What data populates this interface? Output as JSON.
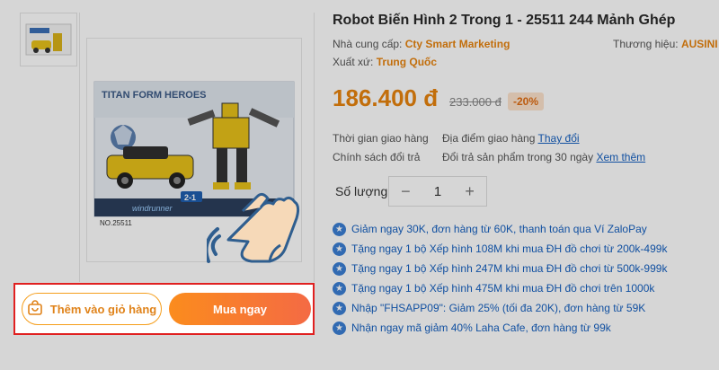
{
  "product": {
    "title": "Robot Biến Hình 2 Trong 1 - 25511 244 Mảnh Ghép",
    "supplier_label": "Nhà cung cấp:",
    "supplier": "Cty Smart Marketing",
    "brand_label": "Thương hiệu:",
    "brand": "AUSINI",
    "origin_label": "Xuất xứ:",
    "origin": "Trung Quốc",
    "price": "186.400 đ",
    "old_price": "233.000 đ",
    "discount": "-20%"
  },
  "image": {
    "brand_text": "TITAN FORM HEROES",
    "model_code": "NO.25511",
    "badge": "2-1",
    "series": "windrunner"
  },
  "shipping": {
    "time_label": "Thời gian giao hàng",
    "location_label": "Địa điểm giao hàng",
    "change_link": "Thay đổi",
    "policy_label": "Chính sách đổi trả",
    "policy_text": "Đổi trả sản phẩm trong 30 ngày",
    "more_link": "Xem thêm"
  },
  "quantity": {
    "label": "Số lượng:",
    "minus": "−",
    "value": "1",
    "plus": "+"
  },
  "promotions": [
    "Giảm ngay 30K, đơn hàng từ 60K, thanh toán qua Ví ZaloPay",
    "Tặng ngay 1 bộ Xếp hình 108M khi mua ĐH đồ chơi từ 200k-499k",
    "Tặng ngay 1 bộ Xếp hình 247M khi mua ĐH đồ chơi từ 500k-999k",
    "Tặng ngay 1 bộ Xếp hình 475M khi mua ĐH đồ chơi trên 1000k",
    "Nhập \"FHSAPP09\": Giảm 25% (tối đa 20K), đơn hàng từ 59K",
    "Nhận ngay mã giảm 40% Laha Cafe, đơn hàng từ 99k"
  ],
  "actions": {
    "add_to_cart": "Thêm vào giỏ hàng",
    "buy_now": "Mua ngay"
  },
  "colors": {
    "accent": "#e8830e",
    "link": "#1560c0",
    "highlight": "#e02020"
  }
}
